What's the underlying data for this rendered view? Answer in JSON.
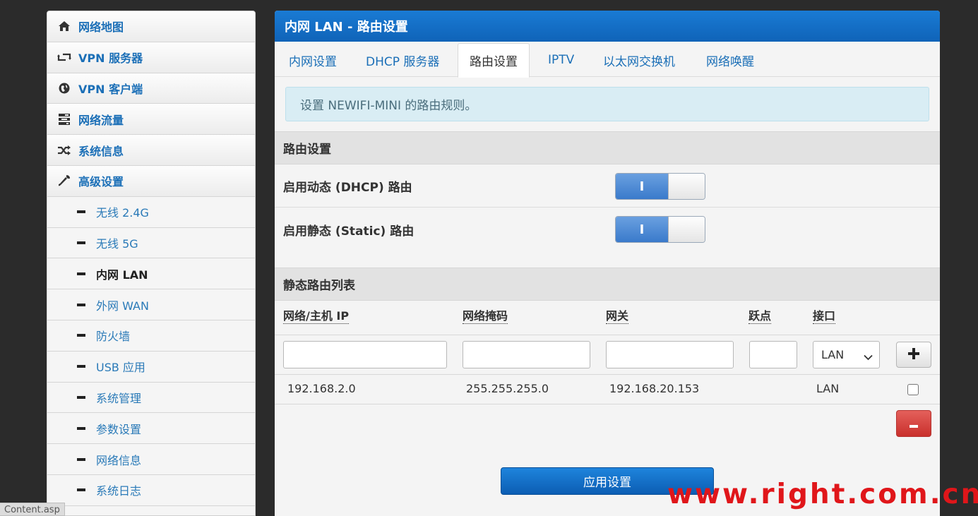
{
  "sidebar": {
    "items": [
      {
        "label": "网络地图",
        "icon": "home-icon"
      },
      {
        "label": "VPN 服务器",
        "icon": "retweet-icon"
      },
      {
        "label": "VPN 客户端",
        "icon": "globe-icon"
      },
      {
        "label": "网络流量",
        "icon": "tasks-icon"
      },
      {
        "label": "系统信息",
        "icon": "random-icon"
      },
      {
        "label": "高级设置",
        "icon": "wrench-icon"
      }
    ],
    "subitems": [
      {
        "label": "无线 2.4G"
      },
      {
        "label": "无线 5G"
      },
      {
        "label": "内网 LAN",
        "active": true
      },
      {
        "label": "外网 WAN"
      },
      {
        "label": "防火墙"
      },
      {
        "label": "USB 应用"
      },
      {
        "label": "系统管理"
      },
      {
        "label": "参数设置"
      },
      {
        "label": "网络信息"
      },
      {
        "label": "系统日志"
      }
    ]
  },
  "statusbar": {
    "text": "Content.asp"
  },
  "panel": {
    "title": "内网 LAN - 路由设置",
    "tabs": [
      "内网设置",
      "DHCP 服务器",
      "路由设置",
      "IPTV",
      "以太网交换机",
      "网络唤醒"
    ],
    "active_tab": "路由设置",
    "info": "设置 NEWIFI-MINI 的路由规则。",
    "section1": {
      "title": "路由设置",
      "rows": [
        {
          "label": "启用动态 (DHCP) 路由",
          "toggle": "on",
          "toggle_text": "I"
        },
        {
          "label": "启用静态 (Static) 路由",
          "toggle": "on",
          "toggle_text": "I"
        }
      ]
    },
    "section2": {
      "title": "静态路由列表",
      "columns": [
        "网络/主机 IP",
        "网络掩码",
        "网关",
        "跃点",
        "接口"
      ],
      "interface_selected": "LAN",
      "routes": [
        {
          "ip": "192.168.2.0",
          "mask": "255.255.255.0",
          "gateway": "192.168.20.153",
          "metric": "",
          "iface": "LAN"
        }
      ]
    },
    "apply_label": "应用设置"
  },
  "watermark": "www.right.com.cn",
  "colors": {
    "accent": "#1b6fb7",
    "header": "#1a7bd4",
    "danger": "#c9302c",
    "watermark": "#e0161a"
  }
}
